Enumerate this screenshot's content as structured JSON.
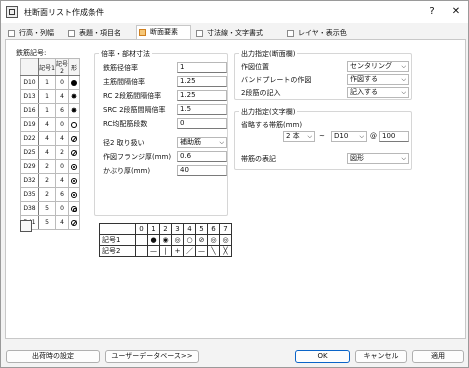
{
  "window": {
    "title": "柱断面リスト作成条件",
    "help_label": "?",
    "close_label": "✕"
  },
  "tabs": [
    {
      "label": "行高・列幅",
      "active": false
    },
    {
      "label": "表題・項目名",
      "active": false
    },
    {
      "label": "断面要素",
      "active": true
    },
    {
      "label": "寸法線・文字書式",
      "active": false
    },
    {
      "label": "レイヤ・表示色",
      "active": false
    }
  ],
  "bar_table": {
    "group_label": "鉄筋記号:",
    "headers": [
      "",
      "記号1",
      "記号2",
      "形"
    ],
    "rows": [
      {
        "dia": "D10",
        "k1": "1",
        "k2": "0",
        "shape": "fill"
      },
      {
        "dia": "D13",
        "k1": "1",
        "k2": "4",
        "shape": "star"
      },
      {
        "dia": "D16",
        "k1": "1",
        "k2": "6",
        "shape": "star"
      },
      {
        "dia": "D19",
        "k1": "4",
        "k2": "0",
        "shape": "ring"
      },
      {
        "dia": "D22",
        "k1": "4",
        "k2": "4",
        "shape": "cross"
      },
      {
        "dia": "D25",
        "k1": "4",
        "k2": "2",
        "shape": "cross"
      },
      {
        "dia": "D29",
        "k1": "2",
        "k2": "0",
        "shape": "dot"
      },
      {
        "dia": "D32",
        "k1": "2",
        "k2": "4",
        "shape": "dot"
      },
      {
        "dia": "D35",
        "k1": "2",
        "k2": "6",
        "shape": "dot"
      },
      {
        "dia": "D38",
        "k1": "5",
        "k2": "0",
        "shape": "ringfill"
      },
      {
        "dia": "D41",
        "k1": "5",
        "k2": "4",
        "shape": "cross"
      }
    ]
  },
  "scale_group": {
    "title": "倍率・部材寸法",
    "fields": [
      {
        "label": "鉄筋径倍率",
        "value": "1"
      },
      {
        "label": "主筋間隔倍率",
        "value": "1.25"
      },
      {
        "label": "RC 2段筋間隔倍率",
        "value": "1.25"
      },
      {
        "label": "SRC 2段筋間隔倍率",
        "value": "1.5"
      },
      {
        "label": "RC均配筋段数",
        "value": "0"
      }
    ],
    "kei_label": "径2 取り扱い",
    "kei_value": "補助筋",
    "flange_label": "作図フランジ厚(mm)",
    "flange_value": "0.6",
    "cover_label": "かぶり厚(mm)",
    "cover_value": "40"
  },
  "output_section": {
    "title": "出力指定(断面欄)",
    "fields": [
      {
        "label": "作図位置",
        "value": "センタリング"
      },
      {
        "label": "バンドプレートの作図",
        "value": "作図する"
      },
      {
        "label": "2段筋の記入",
        "value": "記入する"
      }
    ]
  },
  "output_text": {
    "title": "出力指定(文字欄)",
    "omit_label": "省略する帯筋(mm)",
    "omit_count": "2 本",
    "omit_tilde": "~",
    "omit_size": "D10",
    "omit_at": "@",
    "omit_pitch": "100",
    "hoop_label": "帯筋の表記",
    "hoop_value": "図形"
  },
  "symbol_grid": {
    "headers": [
      "0",
      "1",
      "2",
      "3",
      "4",
      "5",
      "6",
      "7"
    ],
    "row1_label": "記号1",
    "row1": [
      "",
      "●",
      "◉",
      "◎",
      "○",
      "⊘",
      "◎",
      "◎"
    ],
    "row2_label": "記号2",
    "row2": [
      "",
      "—",
      "|",
      "+",
      "／",
      "—",
      "╲",
      "╳"
    ]
  },
  "buttons": {
    "startup": "出荷時の設定",
    "userdb": "ユーザーデータベース>>",
    "ok": "OK",
    "cancel": "キャンセル",
    "apply": "適用"
  }
}
